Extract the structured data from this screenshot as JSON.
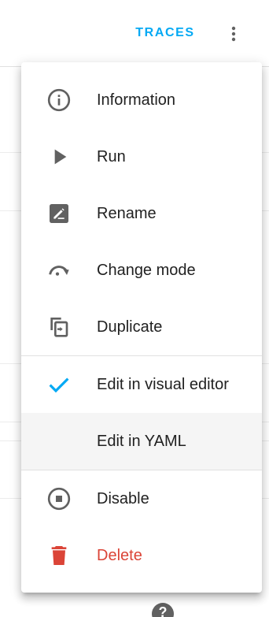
{
  "header": {
    "traces_label": "TRACES",
    "more_icon": "dots-vertical-icon"
  },
  "menu": {
    "items": [
      {
        "label": "Information",
        "icon": "information-outline-icon"
      },
      {
        "label": "Run",
        "icon": "play-icon"
      },
      {
        "label": "Rename",
        "icon": "rename-box-icon"
      },
      {
        "label": "Change mode",
        "icon": "redo-arc-icon"
      },
      {
        "label": "Duplicate",
        "icon": "content-duplicate-icon"
      },
      {
        "label": "Edit in visual editor",
        "icon": "check-icon",
        "selected": true
      },
      {
        "label": "Edit in YAML",
        "icon": "",
        "highlighted": true
      },
      {
        "label": "Disable",
        "icon": "stop-circle-outline-icon"
      },
      {
        "label": "Delete",
        "icon": "delete-icon",
        "danger": true
      }
    ]
  },
  "help": {
    "label": "?"
  },
  "colors": {
    "accent": "#03a9f4",
    "icon": "#616161",
    "danger": "#db4437",
    "text": "#212121",
    "highlight_bg": "#f5f5f5"
  }
}
